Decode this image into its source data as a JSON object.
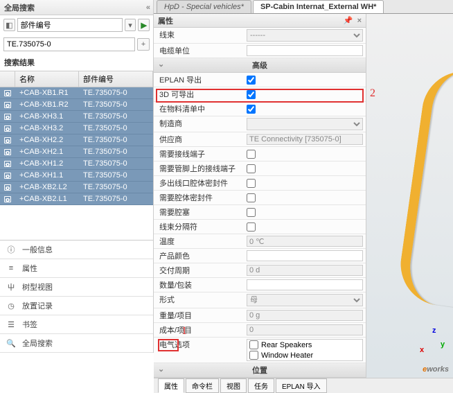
{
  "left": {
    "title": "全局搜索",
    "field": "部件编号",
    "query": "TE.735075-0",
    "results_title": "搜索结果",
    "cols": {
      "name": "名称",
      "pn": "部件编号"
    },
    "rows": [
      {
        "name": "+CAB-XB1.R1",
        "pn": "TE.735075-0"
      },
      {
        "name": "+CAB-XB1.R2",
        "pn": "TE.735075-0"
      },
      {
        "name": "+CAB-XH3.1",
        "pn": "TE.735075-0"
      },
      {
        "name": "+CAB-XH3.2",
        "pn": "TE.735075-0"
      },
      {
        "name": "+CAB-XH2.2",
        "pn": "TE.735075-0"
      },
      {
        "name": "+CAB-XH2.1",
        "pn": "TE.735075-0"
      },
      {
        "name": "+CAB-XH1.2",
        "pn": "TE.735075-0"
      },
      {
        "name": "+CAB-XH1.1",
        "pn": "TE.735075-0"
      },
      {
        "name": "+CAB-XB2.L2",
        "pn": "TE.735075-0"
      },
      {
        "name": "+CAB-XB2.L1",
        "pn": "TE.735075-0"
      }
    ],
    "side": [
      {
        "icon": "ⓘ",
        "label": "一般信息"
      },
      {
        "icon": "≡",
        "label": "属性"
      },
      {
        "icon": "⼬",
        "label": "树型视图"
      },
      {
        "icon": "◷",
        "label": "放置记录"
      },
      {
        "icon": "☰",
        "label": "书签"
      },
      {
        "icon": "🔍",
        "label": "全局搜索"
      }
    ]
  },
  "tabs": [
    {
      "label": "HpD - Special vehicles*",
      "active": false
    },
    {
      "label": "SP-Cabin Internat_External WH*",
      "active": true
    }
  ],
  "prop": {
    "title": "属性",
    "top": [
      {
        "label": "线束",
        "val": "------",
        "type": "select"
      },
      {
        "label": "电缆单位",
        "val": "",
        "type": "text"
      }
    ],
    "adv_title": "高级",
    "adv": [
      {
        "label": "EPLAN 导出",
        "type": "check",
        "val": true
      },
      {
        "label": "3D 可导出",
        "type": "check",
        "val": true
      },
      {
        "label": "在物料清单中",
        "type": "check",
        "val": true,
        "hl": true
      },
      {
        "label": "制造商",
        "type": "select",
        "val": ""
      },
      {
        "label": "供应商",
        "type": "readonly",
        "val": "TE Connectivity [735075-0]"
      },
      {
        "label": "需要接线端子",
        "type": "check",
        "val": false
      },
      {
        "label": "需要管脚上的接线端子",
        "type": "check",
        "val": false
      },
      {
        "label": "多出线口腔体密封件",
        "type": "check",
        "val": false
      },
      {
        "label": "需要腔体密封件",
        "type": "check",
        "val": false
      },
      {
        "label": "需要腔塞",
        "type": "check",
        "val": false
      },
      {
        "label": "线束分隔符",
        "type": "check",
        "val": false
      },
      {
        "label": "温度",
        "type": "readonly",
        "val": "0 ℃"
      },
      {
        "label": "产品颜色",
        "type": "text",
        "val": ""
      },
      {
        "label": "交付周期",
        "type": "readonly",
        "val": "0 d"
      },
      {
        "label": "数量/包装",
        "type": "text",
        "val": ""
      },
      {
        "label": "形式",
        "type": "select",
        "val": "母"
      },
      {
        "label": "重量/项目",
        "type": "readonly",
        "val": "0 g"
      },
      {
        "label": "成本/项目",
        "type": "readonly",
        "val": "0"
      },
      {
        "label": "电气选项",
        "type": "elec",
        "opts": [
          "Rear Speakers",
          "Window Heater"
        ]
      }
    ],
    "pos_title": "位置"
  },
  "btabs": [
    "属性",
    "命令栏",
    "视图",
    "任务",
    "EPLAN 导入"
  ],
  "ann": {
    "one": "1",
    "two": "2"
  },
  "logo": {
    "e": "e",
    "rest": "works"
  }
}
